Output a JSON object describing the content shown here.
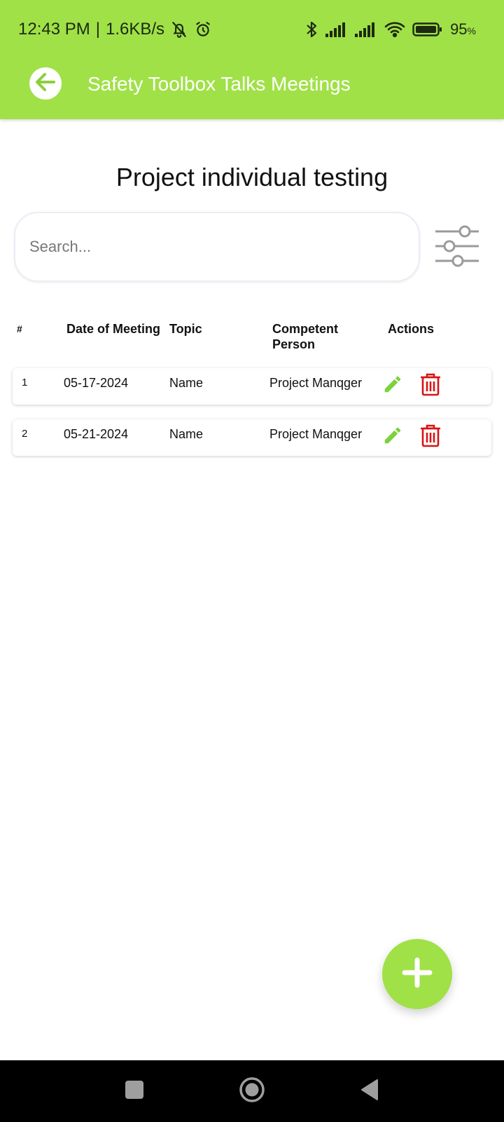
{
  "status_bar": {
    "time": "12:43 PM",
    "separator": "|",
    "network_speed": "1.6KB/s",
    "battery_percent": "95",
    "battery_unit": "%",
    "icons": [
      "bell-off-icon",
      "alarm-icon",
      "bluetooth-icon",
      "signal-icon",
      "signal-icon",
      "wifi-icon",
      "battery-icon"
    ]
  },
  "header": {
    "title": "Safety Toolbox Talks Meetings",
    "back_icon": "arrow-left-icon"
  },
  "main": {
    "page_title": "Project individual testing",
    "search": {
      "placeholder": "Search...",
      "value": ""
    },
    "filter_icon": "sliders-icon"
  },
  "table": {
    "headers": {
      "index": "#",
      "date": "Date of Meeting",
      "topic": "Topic",
      "person_line1": "Competent",
      "person_line2": "Person",
      "actions": "Actions"
    },
    "rows": [
      {
        "index": "1",
        "date": "05-17-2024",
        "topic": "Name",
        "person": "Project Manqger"
      },
      {
        "index": "2",
        "date": "05-21-2024",
        "topic": "Name",
        "person": "Project Manqger"
      }
    ]
  },
  "colors": {
    "brand": "#a0e148",
    "edit": "#7dd13c",
    "delete": "#d81414"
  },
  "fab": {
    "icon": "plus-icon"
  },
  "nav": {
    "icons": [
      "recents-square-icon",
      "home-circle-icon",
      "back-triangle-icon"
    ]
  }
}
